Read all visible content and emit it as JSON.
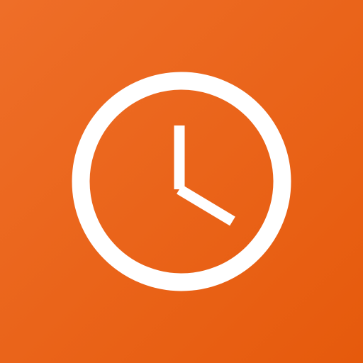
{
  "icon": {
    "name": "clock-icon",
    "colors": {
      "background_start": "#ee6e28",
      "background_end": "#e65a0c",
      "foreground": "#ffffff"
    }
  }
}
